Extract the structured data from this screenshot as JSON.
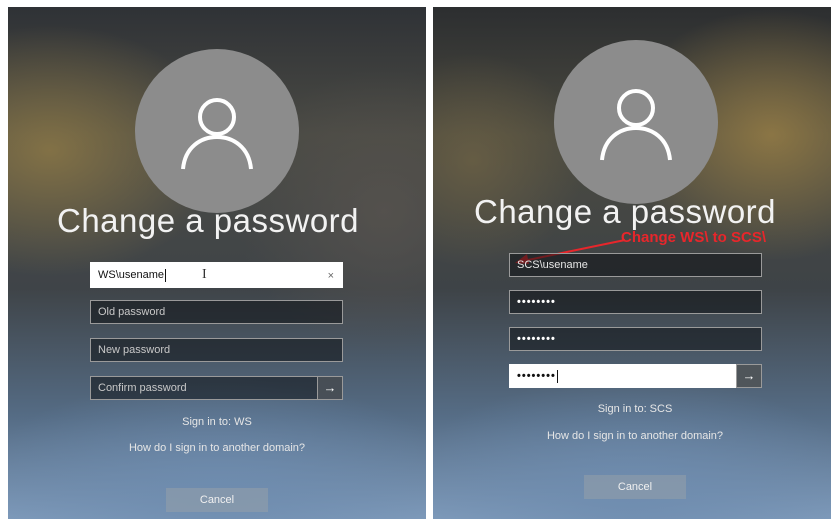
{
  "left": {
    "title": "Change a password",
    "username_value": "WS\\usename",
    "clear_glyph": "×",
    "cursor_glyph": "I",
    "old_password_placeholder": "Old password",
    "new_password_placeholder": "New password",
    "confirm_password_placeholder": "Confirm password",
    "submit_glyph": "→",
    "sign_in_to": "Sign in to: WS",
    "other_domain_link": "How do I sign in to another domain?",
    "cancel_label": "Cancel"
  },
  "right": {
    "title": "Change a password",
    "username_value": "SCS\\usename",
    "old_password_value": "••••••••",
    "new_password_value": "••••••••",
    "confirm_password_value": "••••••••",
    "submit_glyph": "→",
    "sign_in_to": "Sign in to: SCS",
    "other_domain_link": "How do I sign in to another domain?",
    "cancel_label": "Cancel",
    "annotation": "Change WS\\ to SCS\\"
  },
  "colors": {
    "annotation": "#e8262b",
    "avatar": "#8c8c8c"
  },
  "icons": {
    "avatar": "user-icon",
    "submit": "arrow-right-icon",
    "clear": "close-icon"
  }
}
